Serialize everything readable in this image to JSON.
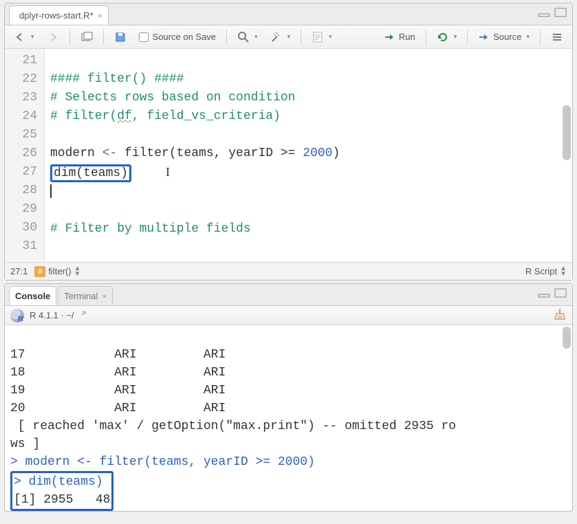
{
  "editor": {
    "tab": {
      "filename": "dplyr-rows-start.R*"
    },
    "toolbar": {
      "source_on_save": "Source on Save",
      "run": "Run",
      "source": "Source"
    },
    "gutter": [
      "21",
      "22",
      "23",
      "24",
      "25",
      "26",
      "27",
      "28",
      "29",
      "30",
      "31"
    ],
    "lines": {
      "l21": "#### filter() ####",
      "l22": "# Selects rows based on condition",
      "l23_a": "# filter(",
      "l23_df": "df",
      "l23_b": ", field_vs_criteria)",
      "l25_a": "modern",
      "l25_op": " <- ",
      "l25_b": "filter(teams, yearID >= ",
      "l25_num": "2000",
      "l25_c": ")",
      "l26": "dim(teams)",
      "l29": "# Filter by multiple fields"
    },
    "status": {
      "pos": "27:1",
      "section": "filter()",
      "type": "R Script"
    }
  },
  "console": {
    "tabs": {
      "console": "Console",
      "terminal": "Terminal"
    },
    "header": "R 4.1.1 · ~/",
    "out": {
      "r17": "17            ARI         ARI",
      "r18": "18            ARI         ARI",
      "r19": "19            ARI         ARI",
      "r20": "20            ARI         ARI",
      "truncated_a": " [ reached 'max' / getOption(\"max.print\") -- omitted 2935 ro",
      "truncated_b": "ws ]"
    },
    "in1": "modern <- filter(teams, yearID >= 2000)",
    "in2": "dim(teams)",
    "res": "[1] 2955   48"
  }
}
